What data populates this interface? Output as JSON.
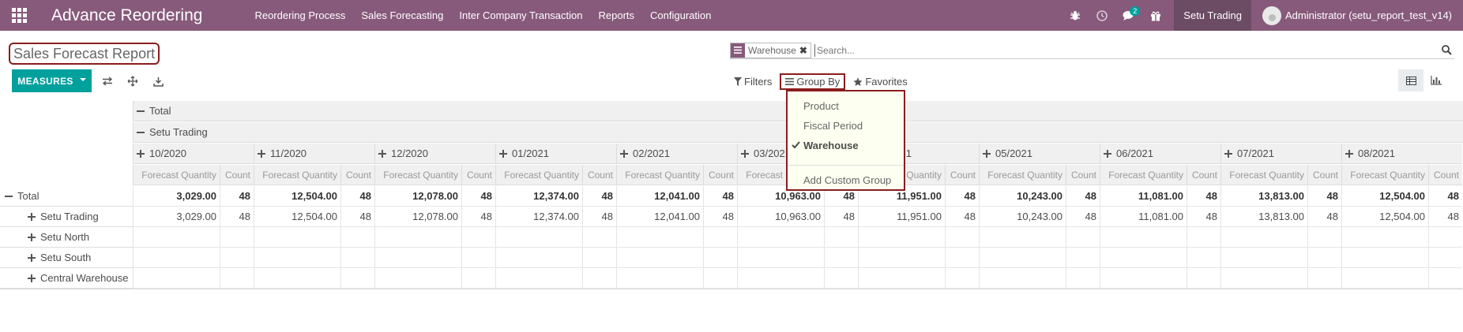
{
  "navbar": {
    "app_title": "Advance Reordering",
    "menu": [
      "Reordering Process",
      "Sales Forecasting",
      "Inter Company Transaction",
      "Reports",
      "Configuration"
    ],
    "messages_badge": "2",
    "company": "Setu Trading",
    "user": "Administrator (setu_report_test_v14)"
  },
  "control_panel": {
    "title": "Sales Forecast Report",
    "search": {
      "facet": "Warehouse",
      "placeholder": "Search..."
    },
    "measures_label": "MEASURES",
    "filters_label": "Filters",
    "groupby_label": "Group By",
    "favorites_label": "Favorites"
  },
  "groupby_menu": {
    "items": [
      "Product",
      "Fiscal Period",
      "Warehouse"
    ],
    "checked": "Warehouse",
    "custom": "Add Custom Group"
  },
  "pivot": {
    "col_total": "Total",
    "col_company": "Setu Trading",
    "periods": [
      "10/2020",
      "11/2020",
      "12/2020",
      "01/2021",
      "02/2021",
      "03/2021",
      "04/2021",
      "05/2021",
      "06/2021",
      "07/2021",
      "08/2021"
    ],
    "measure_labels": [
      "Forecast Quantity",
      "Count"
    ],
    "rows": [
      {
        "label": "Total",
        "values": [
          "3,029.00",
          "48",
          "12,504.00",
          "48",
          "12,078.00",
          "48",
          "12,374.00",
          "48",
          "12,041.00",
          "48",
          "10,963.00",
          "48",
          "11,951.00",
          "48",
          "10,243.00",
          "48",
          "11,081.00",
          "48",
          "13,813.00",
          "48",
          "12,504.00",
          "48"
        ]
      },
      {
        "label": "Setu Trading",
        "values": [
          "3,029.00",
          "48",
          "12,504.00",
          "48",
          "12,078.00",
          "48",
          "12,374.00",
          "48",
          "12,041.00",
          "48",
          "10,963.00",
          "48",
          "11,951.00",
          "48",
          "10,243.00",
          "48",
          "11,081.00",
          "48",
          "13,813.00",
          "48",
          "12,504.00",
          "48"
        ]
      },
      {
        "label": "Setu North",
        "values": []
      },
      {
        "label": "Setu South",
        "values": []
      },
      {
        "label": "Central Warehouse",
        "values": []
      }
    ]
  }
}
